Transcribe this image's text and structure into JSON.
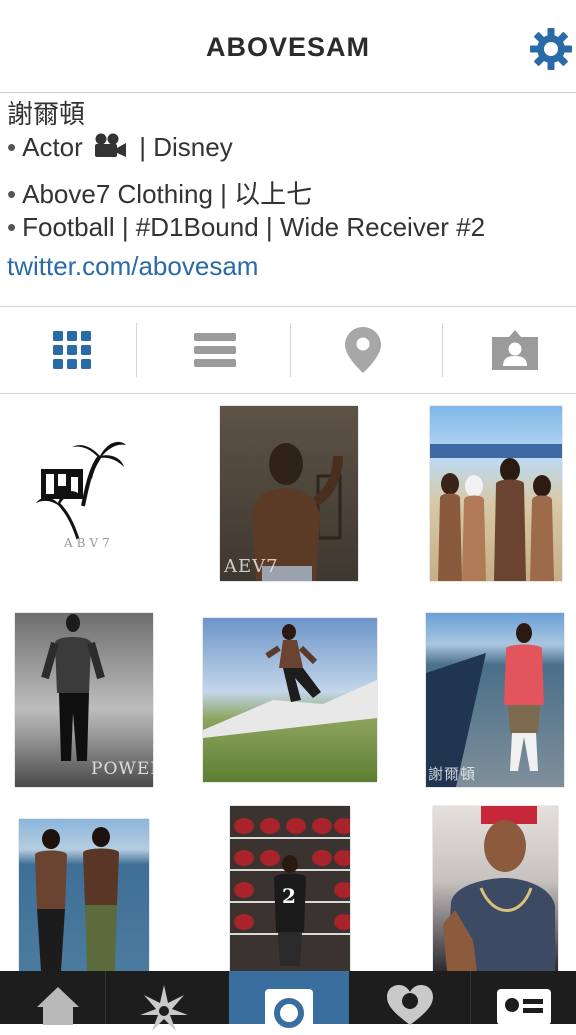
{
  "header": {
    "title": "ABOVESAM"
  },
  "bio": {
    "name": "謝爾頓",
    "bullet": "•",
    "line1_a": "Actor",
    "line1_b": "| Disney",
    "line2": "Above7 Clothing | 以上七",
    "line3": "Football | #D1Bound | Wide Receiver #2",
    "link": "twitter.com/abovesam"
  },
  "tabs": [
    {
      "icon": "grid-icon",
      "active": true
    },
    {
      "icon": "list-icon",
      "active": false
    },
    {
      "icon": "location-pin-icon",
      "active": false
    },
    {
      "icon": "tagged-person-icon",
      "active": false
    }
  ],
  "photos": {
    "p1_caption": "ABV7",
    "p2_caption": "AEV7",
    "p4_caption": "POWER",
    "p6_caption": "謝爾頓",
    "p8_jersey": "2"
  },
  "bottom_nav": [
    {
      "icon": "home-icon"
    },
    {
      "icon": "explore-star-icon"
    },
    {
      "icon": "camera-icon",
      "active": true
    },
    {
      "icon": "heart-icon"
    },
    {
      "icon": "profile-card-icon"
    }
  ],
  "colors": {
    "accent": "#2a6aa6",
    "nav_bg": "#1d1d1d",
    "nav_active": "#3a6e9f"
  }
}
